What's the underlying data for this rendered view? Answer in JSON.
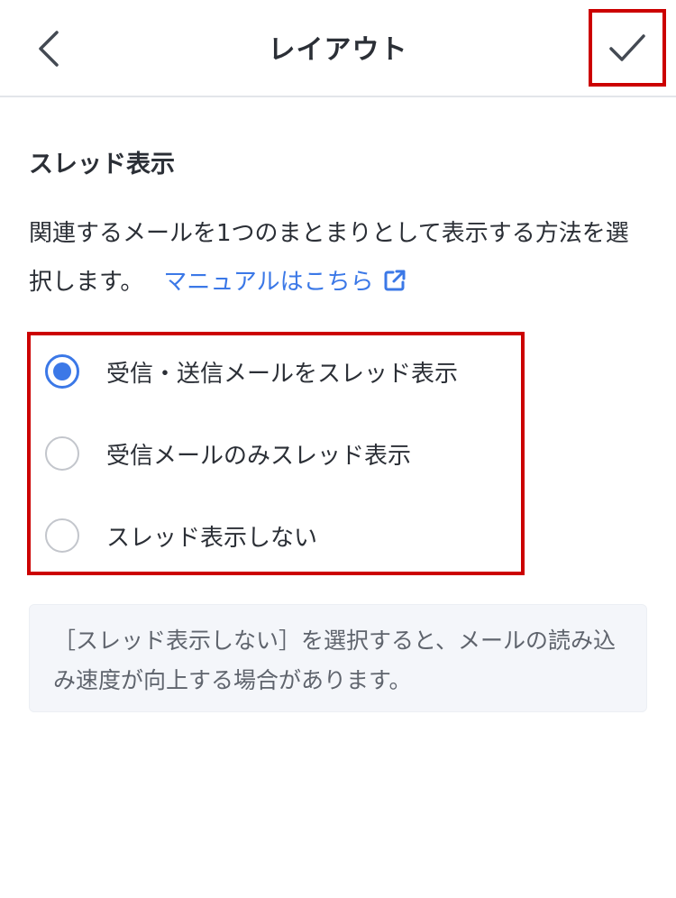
{
  "header": {
    "title": "レイアウト",
    "back_icon": "chevron-left-icon",
    "confirm_icon": "checkmark-icon"
  },
  "section": {
    "title": "スレッド表示",
    "description": "関連するメールを1つのまとまりとして表示する方法を選択します。",
    "manual_link": "マニュアルはこちら",
    "manual_link_icon": "external-link-icon"
  },
  "options": [
    {
      "label": "受信・送信メールをスレッド表示",
      "selected": true
    },
    {
      "label": "受信メールのみスレッド表示",
      "selected": false
    },
    {
      "label": "スレッド表示しない",
      "selected": false
    }
  ],
  "note": {
    "text": "［スレッド表示しない］を選択すると、メールの読み込み速度が向上する場合があります。"
  },
  "colors": {
    "accent": "#3b78e7",
    "highlight_border": "#cc0000",
    "note_background": "#f4f6fa"
  }
}
